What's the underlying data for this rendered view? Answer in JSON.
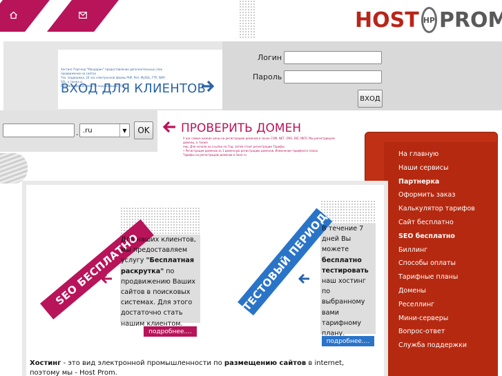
{
  "header": {
    "home_icon": "home-icon",
    "mail_icon": "mail-icon",
    "logo": {
      "part1": "HOST",
      "badge": "НР",
      "part2": "PROM",
      "color_host": "#b8251a",
      "color_prom": "#595959"
    }
  },
  "login": {
    "tiny_text_lines": [
      "Хостинг Партнер \"Мандарин\" предоставление дополнительных слов продвижение на сайтах",
      "Тех. поддержка, 24 час электронной формы PHP, Perl, MySQL, FTP, WAP, SSL, а также  ы.",
      "Про позиции системы по окружающим ТОП"
    ],
    "title": "ВХОД ДЛЯ КЛИЕНТОВ",
    "login_label": "Логин :",
    "password_label": "Пароль :",
    "login_value": "",
    "password_value": "",
    "submit_label": "ВХОД"
  },
  "domain": {
    "title": "ПРОВЕРИТЬ ДОМЕН",
    "input_value": "",
    "dot": ".",
    "zone_selected": ".ru",
    "ok_label": "OK",
    "tiny_text_lines": [
      "У нас самые низкие цены на регистрацию доменов в зонах COM, NET, ORG, BIZ, INFO. Мы регистрируем домены, а также",
      "пер. Для начала  на ссылки на Год, затем стоит регистрации Тарифы",
      "• Регистрация доменов за 1 доменную регистрацию доменов. Изменение тарифного плана",
      "Тарифы на регистрацию доменов в Зоне ru"
    ]
  },
  "sidebar": {
    "items": [
      {
        "label": "На главную",
        "bold": false
      },
      {
        "label": "Наши сервисы",
        "bold": false
      },
      {
        "label": "Партнерка",
        "bold": true
      },
      {
        "label": "Оформить заказ",
        "bold": false
      },
      {
        "label": "Калькулятор тарифов",
        "bold": false
      },
      {
        "label": "Сайт бесплатно",
        "bold": false
      },
      {
        "label": "SEO бесплатно",
        "bold": true
      },
      {
        "label": "Биллинг",
        "bold": false
      },
      {
        "label": "Способы оплаты",
        "bold": false
      },
      {
        "label": "Тарифные планы",
        "bold": false
      },
      {
        "label": "Домены",
        "bold": false
      },
      {
        "label": "Реселлинг",
        "bold": false
      },
      {
        "label": "Мини-серверы",
        "bold": false
      },
      {
        "label": "Вопрос-ответ",
        "bold": false
      },
      {
        "label": "Служба поддержки",
        "bold": false
      }
    ]
  },
  "promos": {
    "seo": {
      "banner": "SEO БЕСПЛАТНО",
      "line1": "Для наших клиентов,",
      "line2": "мы предоставляем",
      "line3_pre": "услугу ",
      "line3_bold": "\"Бесплатная",
      "line4_bold": "раскрутка\"",
      "line4_post": " по",
      "line5": "продвижению Ваших",
      "line6": "сайтов в поисковых",
      "line7": "системах. Для этого",
      "line8": "достаточно стать",
      "line9": "нашим клиентом.",
      "more": "подробнее....",
      "color": "#b8145a"
    },
    "trial": {
      "banner": "ТЕСТОВЫЙ ПЕРИОД",
      "line1": "В течение 7",
      "line2": "дней Вы",
      "line3": "можете",
      "line4_bold": "бесплатно",
      "line5_bold": "тестировать",
      "line6": "наш хостинг",
      "line7": "по",
      "line8": "выбранному",
      "line9": "вами",
      "line10": "тарифному",
      "line11": "плану.",
      "more": "подробнее....",
      "color": "#2a74c8"
    }
  },
  "footer_text": {
    "bold1": "Хостинг",
    "text1": " - это вид электронной промышленности по ",
    "bold2": "размещению сайтов",
    "text2": " в internet, поэтому мы - Host Prom."
  }
}
